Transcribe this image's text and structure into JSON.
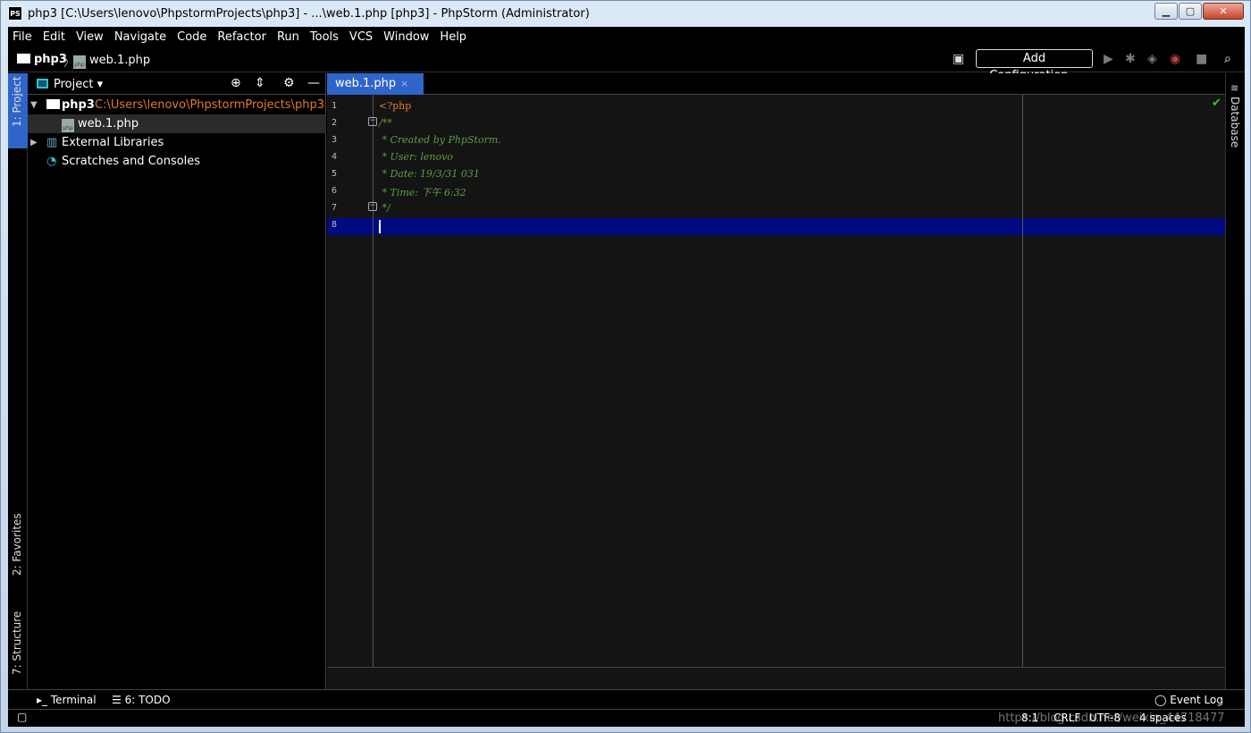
{
  "window": {
    "title": "php3 [C:\\Users\\lenovo\\PhpstormProjects\\php3] - ...\\web.1.php [php3] - PhpStorm (Administrator)",
    "app_icon": "PS",
    "minimize": "▁",
    "maximize": "▢",
    "close": "✕"
  },
  "menu": [
    "File",
    "Edit",
    "View",
    "Navigate",
    "Code",
    "Refactor",
    "Run",
    "Tools",
    "VCS",
    "Window",
    "Help"
  ],
  "breadcrumb": {
    "project": "php3",
    "separator": "〉",
    "file": "web.1.php"
  },
  "toolbar": {
    "add_configuration": "Add Configuration..."
  },
  "left_tabs": {
    "project": "1: Project",
    "favorites": "2: Favorites",
    "structure": "7: Structure"
  },
  "right_tabs": {
    "database": "Database"
  },
  "project_panel": {
    "title": "Project",
    "tree": [
      {
        "label": "php3",
        "path": "C:\\Users\\lenovo\\PhpstormProjects\\php3"
      },
      {
        "label": "web.1.php"
      },
      {
        "label": "External Libraries"
      },
      {
        "label": "Scratches and Consoles"
      }
    ]
  },
  "editor": {
    "tab_label": "web.1.php",
    "tab_close": "×",
    "lines": [
      {
        "num": "1",
        "text": "<?php"
      },
      {
        "num": "2",
        "text": "/**"
      },
      {
        "num": "3",
        "text": " * Created by PhpStorm."
      },
      {
        "num": "4",
        "text": " * User: lenovo"
      },
      {
        "num": "5",
        "text": " * Date: 19/3/31 031"
      },
      {
        "num": "6",
        "text": " * Time: 下午 6:32"
      },
      {
        "num": "7",
        "text": " */"
      },
      {
        "num": "8",
        "text": ""
      }
    ],
    "check_mark": "✔"
  },
  "bottom_tools": {
    "terminal": "Terminal",
    "todo": "6: TODO",
    "event_log": "Event Log"
  },
  "status": {
    "position": "8:1",
    "line_sep": "CRLF",
    "encoding": "UTF-8",
    "indent": "4 spaces",
    "watermark": "https://blog.csdn.net/weixin_44718477"
  },
  "colors": {
    "accent": "#2f65ca",
    "current_line": "#000a80",
    "comment": "#5d9e43",
    "php_tag": "#e07b2b",
    "path": "#e07b2b"
  }
}
